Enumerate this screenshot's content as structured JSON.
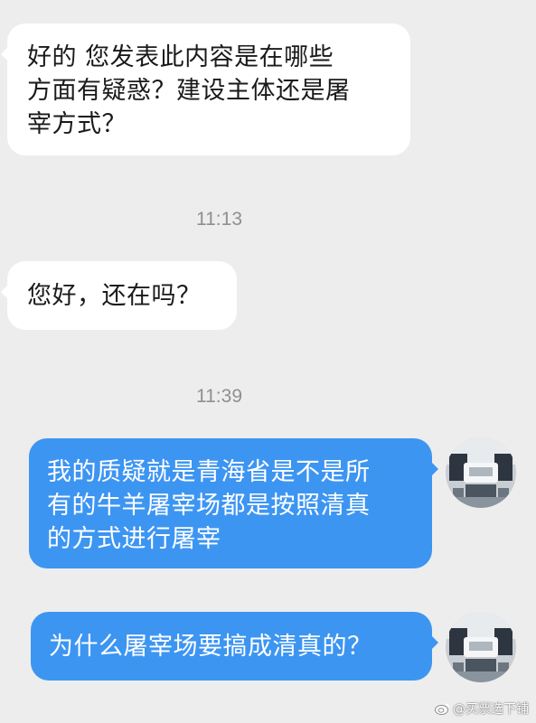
{
  "conversation": {
    "msg1": {
      "lines": [
        "好的 您发表此内容是在哪些",
        "方面有疑惑？建设主体还是屠",
        "宰方式？"
      ]
    },
    "time1": "11:13",
    "msg2": {
      "lines": [
        "您好，还在吗？"
      ]
    },
    "time2": "11:39",
    "msg3": {
      "lines": [
        "我的质疑就是青海省是不是所",
        "有的牛羊屠宰场都是按照清真",
        "的方式进行屠宰"
      ]
    },
    "msg4": {
      "lines": [
        "为什么屠宰场要搞成清真的？"
      ]
    }
  },
  "watermark": {
    "text": "@买票选下铺",
    "icon": "weibo-icon"
  },
  "colors": {
    "background": "#ededed",
    "incoming_bubble": "#ffffff",
    "outgoing_bubble": "#3d95f2",
    "timestamp": "#8f8f8f"
  }
}
